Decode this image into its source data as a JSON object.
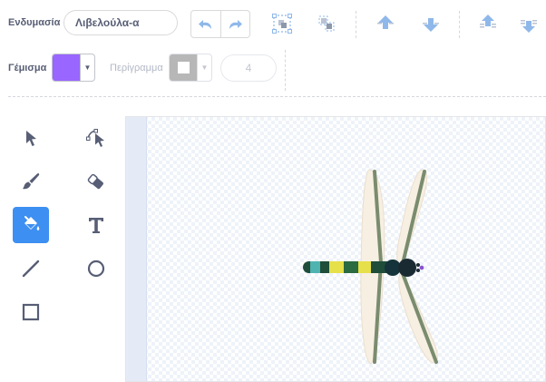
{
  "toolbar": {
    "costume_label": "Ενδυμασία",
    "costume_name": "Λιβελούλα-α",
    "fill_label": "Γέμισμα",
    "fill_color": "#9966ff",
    "outline_label": "Περίγραμμα",
    "outline_color": "#b7b7b7",
    "outline_width": "4"
  },
  "icons": {
    "undo": "undo-icon",
    "redo": "redo-icon",
    "group": "group-icon",
    "ungroup": "ungroup-icon",
    "forward": "forward-icon",
    "backward": "backward-icon",
    "front": "front-icon",
    "back": "back-icon"
  },
  "tools": [
    {
      "name": "select",
      "active": false
    },
    {
      "name": "reshape",
      "active": false
    },
    {
      "name": "brush",
      "active": false
    },
    {
      "name": "eraser",
      "active": false
    },
    {
      "name": "fill",
      "active": true
    },
    {
      "name": "text",
      "active": false
    },
    {
      "name": "line",
      "active": false
    },
    {
      "name": "circle",
      "active": false
    },
    {
      "name": "rectangle",
      "active": false
    }
  ],
  "colors": {
    "accent": "#3d8ff2",
    "text": "#575e75",
    "icon_light": "#8fb8ea"
  }
}
